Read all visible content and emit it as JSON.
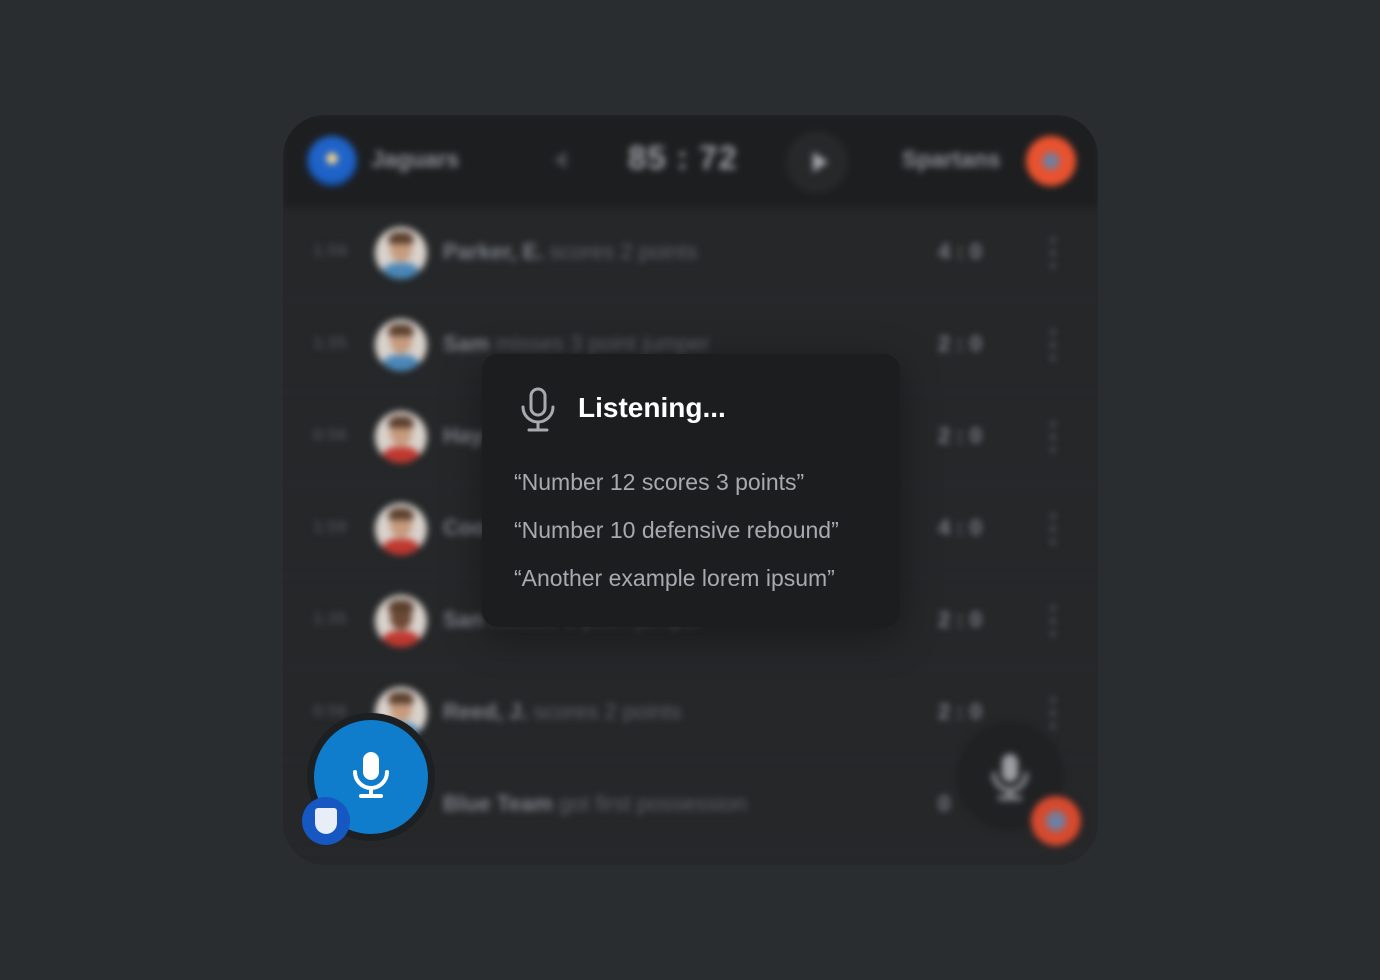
{
  "header": {
    "home_team": "Jaguars",
    "away_team": "Spartans",
    "score": "85 : 72"
  },
  "events": [
    {
      "time": "1:59",
      "name": "Parker, E.",
      "action": " scores 2 points",
      "score": "4 : 0",
      "team": "blue"
    },
    {
      "time": "1:35",
      "name": "Sam",
      "action": " misses 3 point jumper",
      "score": "2 : 0",
      "team": "blue"
    },
    {
      "time": "0:56",
      "name": "Hay",
      "action": "",
      "score": "2 : 0",
      "team": "red"
    },
    {
      "time": "1:59",
      "name": "Coo",
      "action": "",
      "score": "4 : 0",
      "team": "red"
    },
    {
      "time": "1:35",
      "name": "San",
      "action": " misses 3 point jumper",
      "score": "2 : 0",
      "team": "red"
    },
    {
      "time": "0:56",
      "name": "Reed, J.",
      "action": " scores 2 points",
      "score": "2 : 0",
      "team": "blue"
    },
    {
      "time": "",
      "name": "Blue Team",
      "action": " got first possession",
      "score": "0",
      "team": "none"
    }
  ],
  "listening": {
    "title": "Listening...",
    "examples": [
      "“Number 12 scores 3 points”",
      "“Number 10 defensive rebound”",
      "“Another example lorem ipsum”"
    ]
  },
  "colors": {
    "background": "#2a2d30",
    "card": "#252729",
    "accent_blue": "#0f7ccc",
    "away_orange": "#e8522f",
    "popover": "#1c1d1f"
  }
}
